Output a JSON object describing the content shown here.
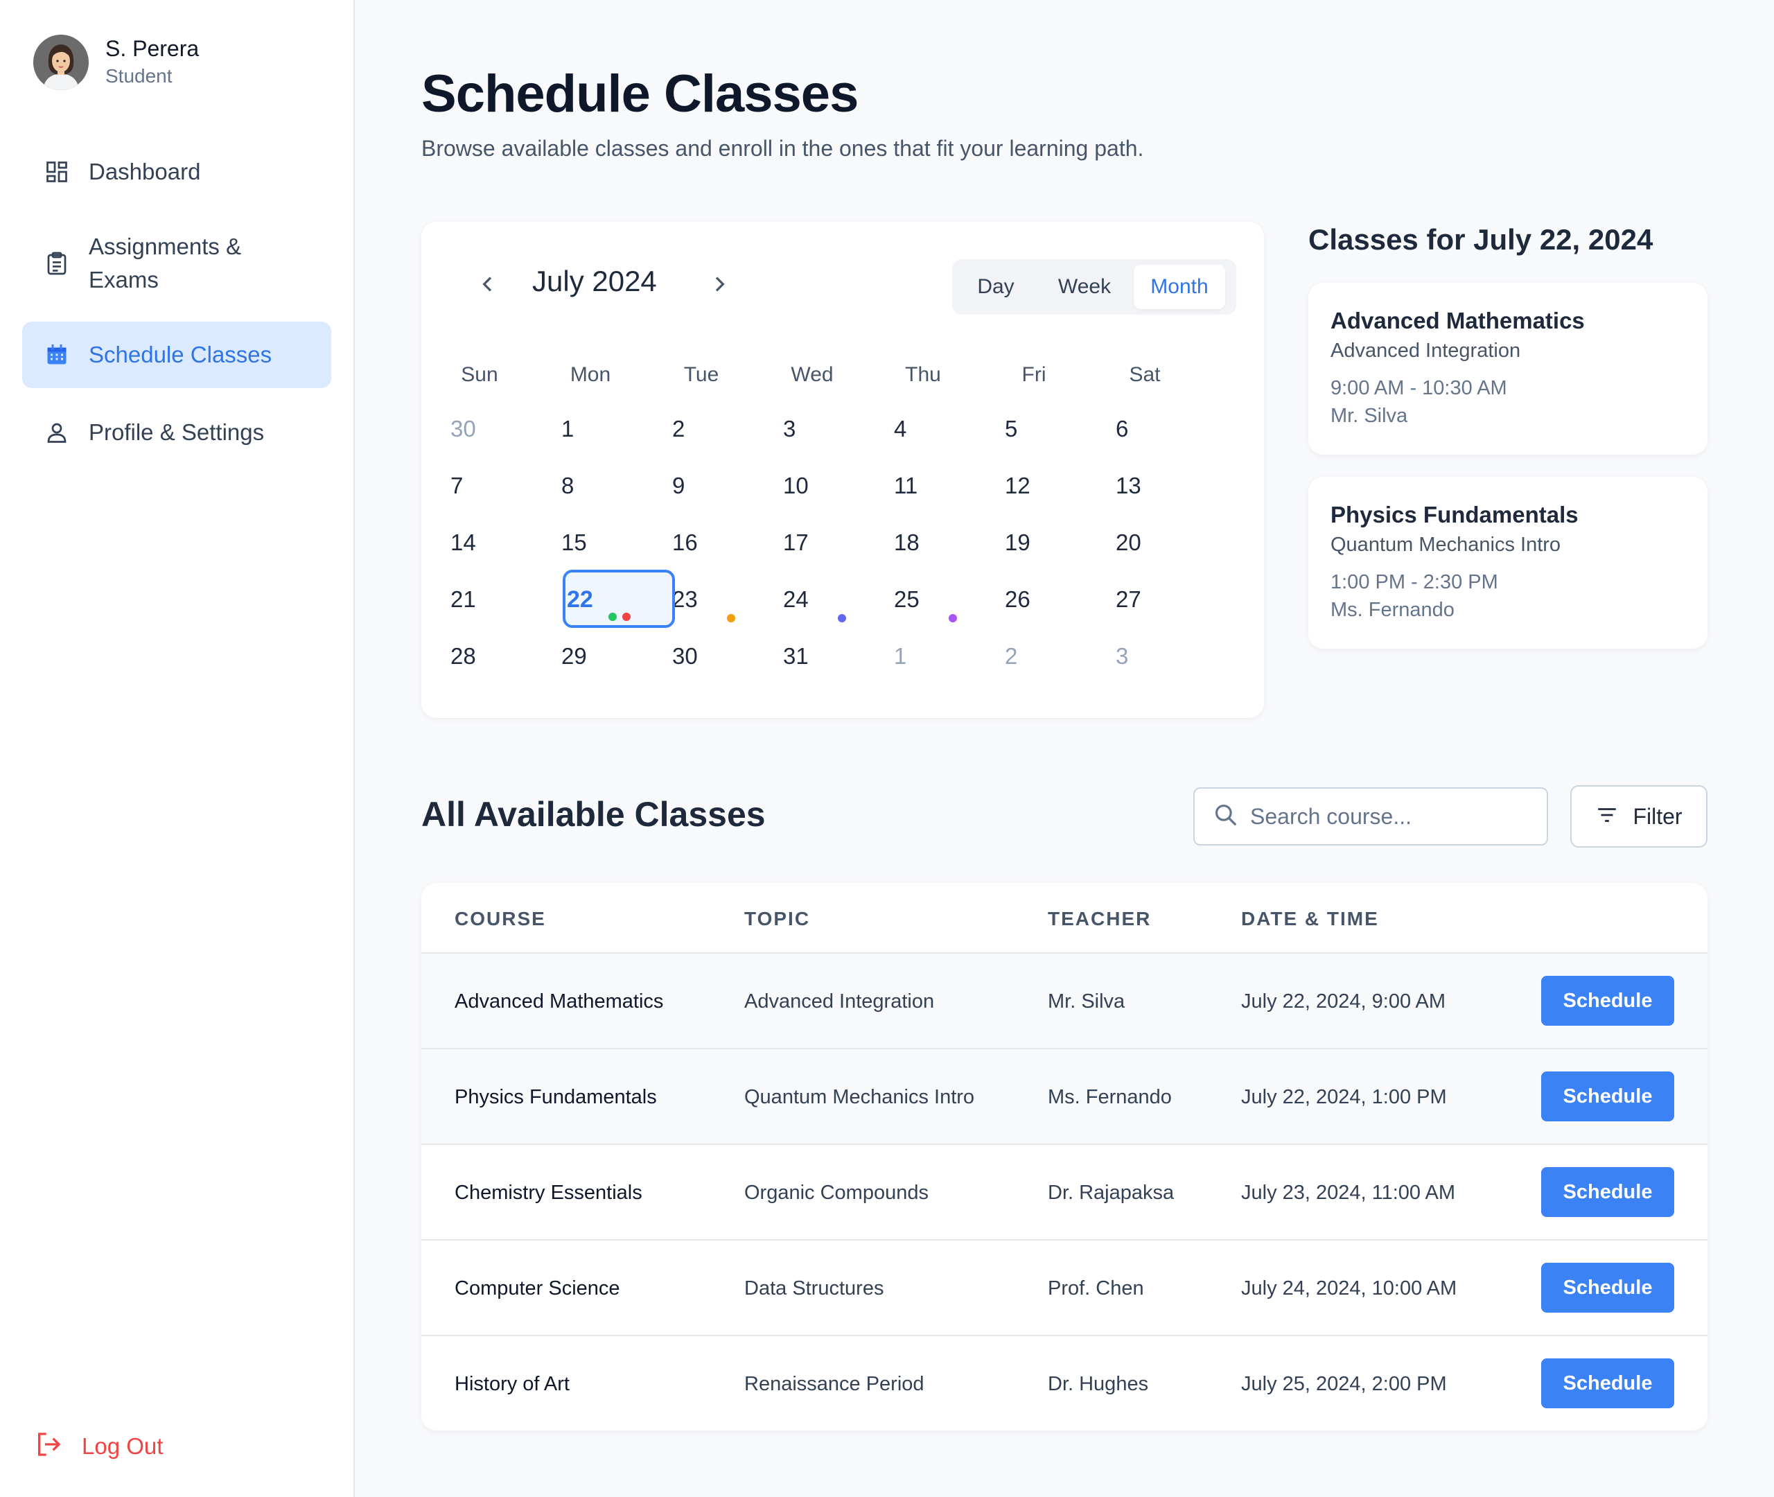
{
  "user": {
    "name": "S. Perera",
    "role": "Student"
  },
  "nav": {
    "items": [
      {
        "label": "Dashboard",
        "icon": "dashboard-icon"
      },
      {
        "label": "Assignments & Exams",
        "icon": "clipboard-icon"
      },
      {
        "label": "Schedule Classes",
        "icon": "calendar-icon",
        "active": true
      },
      {
        "label": "Profile & Settings",
        "icon": "user-icon"
      }
    ],
    "logout": "Log Out"
  },
  "page": {
    "title": "Schedule Classes",
    "subtitle": "Browse available classes and enroll in the ones that fit your learning path."
  },
  "calendar": {
    "month_label": "July 2024",
    "views": [
      "Day",
      "Week",
      "Month"
    ],
    "active_view": "Month",
    "weekdays": [
      "Sun",
      "Mon",
      "Tue",
      "Wed",
      "Thu",
      "Fri",
      "Sat"
    ],
    "weeks": [
      [
        "30",
        "1",
        "2",
        "3",
        "4",
        "5",
        "6"
      ],
      [
        "7",
        "8",
        "9",
        "10",
        "11",
        "12",
        "13"
      ],
      [
        "14",
        "15",
        "16",
        "17",
        "18",
        "19",
        "20"
      ],
      [
        "21",
        "22",
        "23",
        "24",
        "25",
        "26",
        "27"
      ],
      [
        "28",
        "29",
        "30",
        "31",
        "1",
        "2",
        "3"
      ]
    ],
    "selected_day": "22",
    "event_colors": {
      "green": "#22c55e",
      "red": "#ef4444",
      "amber": "#f59e0b",
      "indigo": "#6366f1",
      "purple": "#a855f7"
    }
  },
  "day_panel": {
    "title": "Classes for July 22, 2024",
    "classes": [
      {
        "course": "Advanced Mathematics",
        "topic": "Advanced Integration",
        "time": "9:00 AM - 10:30 AM",
        "teacher": "Mr. Silva"
      },
      {
        "course": "Physics Fundamentals",
        "topic": "Quantum Mechanics Intro",
        "time": "1:00 PM - 2:30 PM",
        "teacher": "Ms. Fernando"
      }
    ]
  },
  "all_classes": {
    "title": "All Available Classes",
    "search_placeholder": "Search course...",
    "filter_label": "Filter",
    "columns": [
      "COURSE",
      "TOPIC",
      "TEACHER",
      "DATE & TIME"
    ],
    "action_label": "Schedule",
    "rows": [
      {
        "course": "Advanced Mathematics",
        "topic": "Advanced Integration",
        "teacher": "Mr. Silva",
        "datetime": "July 22, 2024, 9:00 AM"
      },
      {
        "course": "Physics Fundamentals",
        "topic": "Quantum Mechanics Intro",
        "teacher": "Ms. Fernando",
        "datetime": "July 22, 2024, 1:00 PM"
      },
      {
        "course": "Chemistry Essentials",
        "topic": "Organic Compounds",
        "teacher": "Dr. Rajapaksa",
        "datetime": "July 23, 2024, 11:00 AM"
      },
      {
        "course": "Computer Science",
        "topic": "Data Structures",
        "teacher": "Prof. Chen",
        "datetime": "July 24, 2024, 10:00 AM"
      },
      {
        "course": "History of Art",
        "topic": "Renaissance Period",
        "teacher": "Dr. Hughes",
        "datetime": "July 25, 2024, 2:00 PM"
      }
    ]
  },
  "colors": {
    "accent": "#3b82f6",
    "accent_text": "#2f74e8",
    "danger": "#ef4444",
    "active_nav_bg": "#dbeafe"
  }
}
